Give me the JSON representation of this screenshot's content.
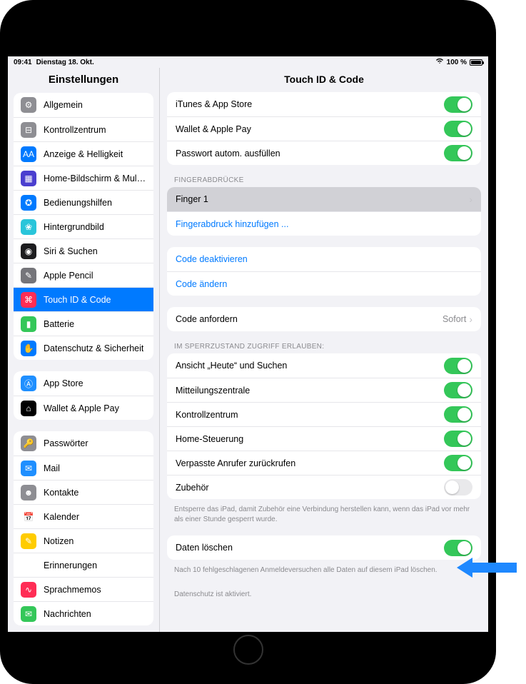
{
  "status": {
    "time": "09:41",
    "date": "Dienstag 18. Okt.",
    "battery_pct": "100 %"
  },
  "sidebar": {
    "title": "Einstellungen",
    "groups": [
      {
        "items": [
          {
            "label": "Allgemein",
            "icon_bg": "#8e8e93",
            "glyph": "⚙",
            "selected": false
          },
          {
            "label": "Kontrollzentrum",
            "icon_bg": "#8e8e93",
            "glyph": "⊟",
            "selected": false
          },
          {
            "label": "Anzeige & Helligkeit",
            "icon_bg": "#007aff",
            "glyph": "AA",
            "selected": false
          },
          {
            "label": "Home-Bildschirm & Multi...",
            "icon_bg": "#4b3fcf",
            "glyph": "▦",
            "selected": false
          },
          {
            "label": "Bedienungshilfen",
            "icon_bg": "#007aff",
            "glyph": "✪",
            "selected": false
          },
          {
            "label": "Hintergrundbild",
            "icon_bg": "#29c5da",
            "glyph": "❀",
            "selected": false
          },
          {
            "label": "Siri & Suchen",
            "icon_bg": "#1d1d1f",
            "glyph": "◉",
            "selected": false
          },
          {
            "label": "Apple Pencil",
            "icon_bg": "#75757a",
            "glyph": "✎",
            "selected": false
          },
          {
            "label": "Touch ID & Code",
            "icon_bg": "#ff2d55",
            "glyph": "⌘",
            "selected": true
          },
          {
            "label": "Batterie",
            "icon_bg": "#34c759",
            "glyph": "▮",
            "selected": false
          },
          {
            "label": "Datenschutz & Sicherheit",
            "icon_bg": "#007aff",
            "glyph": "✋",
            "selected": false
          }
        ]
      },
      {
        "items": [
          {
            "label": "App Store",
            "icon_bg": "#1f8fff",
            "glyph": "Ⓐ",
            "selected": false
          },
          {
            "label": "Wallet & Apple Pay",
            "icon_bg": "#000",
            "glyph": "⌂",
            "selected": false
          }
        ]
      },
      {
        "items": [
          {
            "label": "Passwörter",
            "icon_bg": "#8e8e93",
            "glyph": "🔑",
            "selected": false
          },
          {
            "label": "Mail",
            "icon_bg": "#1f8fff",
            "glyph": "✉",
            "selected": false
          },
          {
            "label": "Kontakte",
            "icon_bg": "#8e8e93",
            "glyph": "☻",
            "selected": false
          },
          {
            "label": "Kalender",
            "icon_bg": "#ffffff",
            "glyph": "📅",
            "selected": false
          },
          {
            "label": "Notizen",
            "icon_bg": "#ffcc00",
            "glyph": "✎",
            "selected": false
          },
          {
            "label": "Erinnerungen",
            "icon_bg": "#ffffff",
            "glyph": "☑",
            "selected": false
          },
          {
            "label": "Sprachmemos",
            "icon_bg": "#ff2d55",
            "glyph": "∿",
            "selected": false
          },
          {
            "label": "Nachrichten",
            "icon_bg": "#34c759",
            "glyph": "✉",
            "selected": false
          }
        ]
      }
    ]
  },
  "detail": {
    "title": "Touch ID & Code",
    "touchid_uses": [
      {
        "label": "iTunes & App Store",
        "on": true
      },
      {
        "label": "Wallet & Apple Pay",
        "on": true
      },
      {
        "label": "Passwort autom. ausfüllen",
        "on": true
      }
    ],
    "fingerprints_header": "FINGERABDRÜCKE",
    "fingerprints": [
      {
        "label": "Finger 1",
        "highlight": true
      },
      {
        "label": "Fingerabdruck hinzufügen ...",
        "link": true
      }
    ],
    "code_actions": [
      {
        "label": "Code deaktivieren"
      },
      {
        "label": "Code ändern"
      }
    ],
    "require_code": {
      "label": "Code anfordern",
      "value": "Sofort"
    },
    "lock_header": "IM SPERRZUSTAND ZUGRIFF ERLAUBEN:",
    "lock_access": [
      {
        "label": "Ansicht „Heute“ und Suchen",
        "on": true
      },
      {
        "label": "Mitteilungszentrale",
        "on": true
      },
      {
        "label": "Kontrollzentrum",
        "on": true
      },
      {
        "label": "Home-Steuerung",
        "on": true
      },
      {
        "label": "Verpasste Anrufer zurückrufen",
        "on": true
      },
      {
        "label": "Zubehör",
        "on": false
      }
    ],
    "lock_footer": "Entsperre das iPad, damit Zubehör eine Verbindung herstellen kann, wenn das iPad vor mehr als einer Stunde gesperrt wurde.",
    "erase": {
      "label": "Daten löschen",
      "on": true
    },
    "erase_footer1": "Nach 10 fehlgeschlagenen Anmeldeversuchen alle Daten auf diesem iPad löschen.",
    "erase_footer2": "Datenschutz ist aktiviert."
  }
}
